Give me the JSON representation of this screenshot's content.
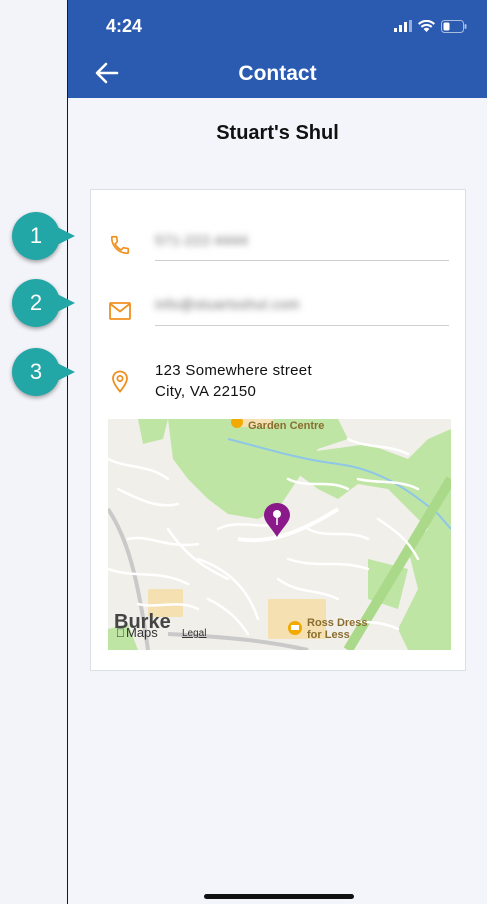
{
  "status_bar": {
    "time": "4:24"
  },
  "nav": {
    "title": "Contact"
  },
  "venue": {
    "name": "Stuart's Shul"
  },
  "contact": {
    "phone": "571-222-4444",
    "email": "info@stuartsshul.com",
    "address_line1": "123 Somewhere street",
    "address_line2": "City, VA 22150"
  },
  "map": {
    "labels": {
      "garden_centre": "Garden Centre",
      "store_line1": "Ross Dress",
      "store_line2": "for Less",
      "town": "Burke",
      "maps_brand": "Maps",
      "legal": "Legal"
    }
  },
  "annotations": [
    "1",
    "2",
    "3"
  ],
  "colors": {
    "header": "#2a5bb0",
    "accent_icon": "#f0901e",
    "callout": "#22a6a6",
    "pin": "#8a1a8a",
    "map_green": "#bfe5a5"
  }
}
